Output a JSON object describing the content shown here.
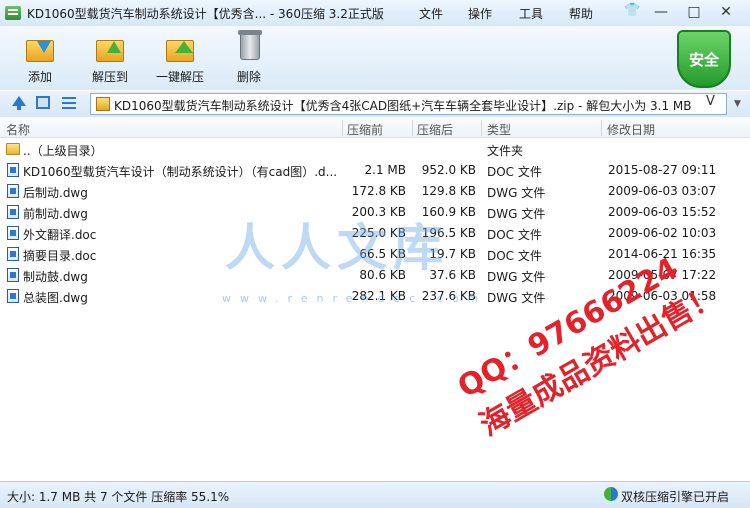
{
  "window": {
    "title": "KD1060型载货汽车制动系统设计【优秀含... - 360压缩 3.2正式版",
    "menu": [
      "文件",
      "操作",
      "工具",
      "帮助"
    ],
    "controls": {
      "minimize": "—",
      "maximize": "□",
      "close": "✕"
    }
  },
  "toolbar": {
    "buttons": [
      {
        "label": "添加",
        "icon": "add-icon"
      },
      {
        "label": "解压到",
        "icon": "extract-to-icon"
      },
      {
        "label": "一键解压",
        "icon": "one-click-extract-icon"
      },
      {
        "label": "删除",
        "icon": "delete-icon"
      }
    ],
    "security_badge": "安全"
  },
  "address": {
    "path": "KD1060型载货汽车制动系统设计【优秀含4张CAD图纸+汽车车辆全套毕业设计】.zip - 解包大小为 3.1 MB",
    "v_label": "V"
  },
  "list": {
    "columns": [
      "名称",
      "压缩前",
      "压缩后",
      "类型",
      "修改日期"
    ],
    "parent": {
      "name": "..（上级目录）",
      "type": "文件夹"
    },
    "rows": [
      {
        "name": "KD1060型载货汽车设计（制动系统设计）（有cad图）.d...",
        "before": "2.1 MB",
        "after": "952.0 KB",
        "type": "DOC 文件",
        "date": "2015-08-27 09:11"
      },
      {
        "name": "后制动.dwg",
        "before": "172.8 KB",
        "after": "129.8 KB",
        "type": "DWG 文件",
        "date": "2009-06-03 03:07"
      },
      {
        "name": "前制动.dwg",
        "before": "200.3 KB",
        "after": "160.9 KB",
        "type": "DWG 文件",
        "date": "2009-06-03 15:52"
      },
      {
        "name": "外文翻译.doc",
        "before": "225.0 KB",
        "after": "196.5 KB",
        "type": "DOC 文件",
        "date": "2009-06-02 10:03"
      },
      {
        "name": "摘要目录.doc",
        "before": "66.5 KB",
        "after": "19.7 KB",
        "type": "DOC 文件",
        "date": "2014-06-21 16:35"
      },
      {
        "name": "制动鼓.dwg",
        "before": "80.6 KB",
        "after": "37.6 KB",
        "type": "DWG 文件",
        "date": "2009-05-07 17:22"
      },
      {
        "name": "总装图.dwg",
        "before": "282.1 KB",
        "after": "237.6 KB",
        "type": "DWG 文件",
        "date": "2009-06-03 01:58"
      }
    ]
  },
  "watermark": {
    "big": "人人文库",
    "url": "www.renrendoc.com",
    "stamp_qq": "QQ：97666224",
    "stamp_ad": "海量成品资料出售！"
  },
  "status": {
    "summary": "大小: 1.7 MB 共 7 个文件 压缩率 55.1%",
    "engine": "双核压缩引擎已开启"
  },
  "colors": {
    "accent": "#2b78d0",
    "security": "#2f9e35",
    "stamp": "#e3232b"
  }
}
